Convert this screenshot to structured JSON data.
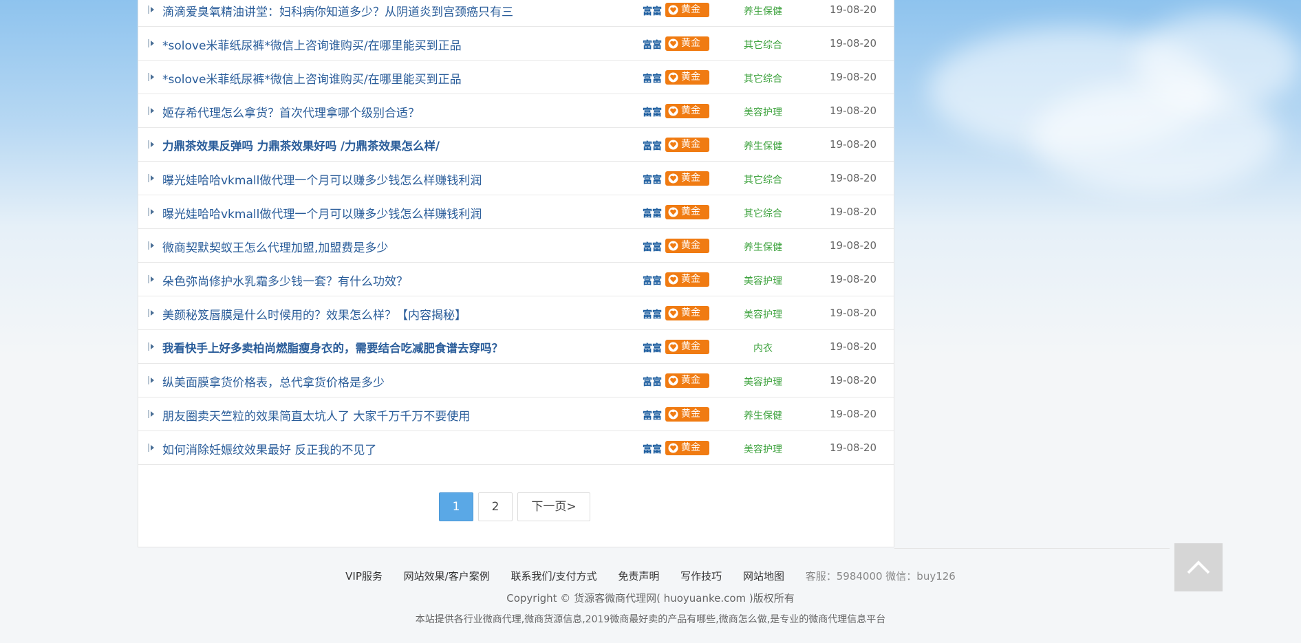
{
  "posts": [
    {
      "title": "滴滴爱臭氧精油讲堂：妇科病你知道多少？从阴道炎到宫颈癌只有三",
      "bold": false,
      "user": "富富",
      "badge": "黄金",
      "category": "养生保健",
      "date": "19-08-20"
    },
    {
      "title": "*solove米菲纸尿裤*微信上咨询谁购买/在哪里能买到正品",
      "bold": false,
      "user": "富富",
      "badge": "黄金",
      "category": "其它综合",
      "date": "19-08-20"
    },
    {
      "title": "*solove米菲纸尿裤*微信上咨询谁购买/在哪里能买到正品",
      "bold": false,
      "user": "富富",
      "badge": "黄金",
      "category": "其它综合",
      "date": "19-08-20"
    },
    {
      "title": "姬存希代理怎么拿货？首次代理拿哪个级别合适？",
      "bold": false,
      "user": "富富",
      "badge": "黄金",
      "category": "美容护理",
      "date": "19-08-20"
    },
    {
      "title": "力鼎茶效果反弹吗 力鼎茶效果好吗 /力鼎茶效果怎么样/",
      "bold": true,
      "user": "富富",
      "badge": "黄金",
      "category": "养生保健",
      "date": "19-08-20"
    },
    {
      "title": "曝光娃哈哈vkmall做代理一个月可以赚多少钱怎么样赚钱利润",
      "bold": false,
      "user": "富富",
      "badge": "黄金",
      "category": "其它综合",
      "date": "19-08-20"
    },
    {
      "title": "曝光娃哈哈vkmall做代理一个月可以赚多少钱怎么样赚钱利润",
      "bold": false,
      "user": "富富",
      "badge": "黄金",
      "category": "其它综合",
      "date": "19-08-20"
    },
    {
      "title": "微商契默契蚁王怎么代理加盟,加盟费是多少",
      "bold": false,
      "user": "富富",
      "badge": "黄金",
      "category": "养生保健",
      "date": "19-08-20"
    },
    {
      "title": "朵色弥尚修护水乳霜多少钱一套？有什么功效？",
      "bold": false,
      "user": "富富",
      "badge": "黄金",
      "category": "美容护理",
      "date": "19-08-20"
    },
    {
      "title": "美颜秘笈唇膜是什么时候用的？效果怎么样？【内容揭秘】",
      "bold": false,
      "user": "富富",
      "badge": "黄金",
      "category": "美容护理",
      "date": "19-08-20"
    },
    {
      "title": "我看快手上好多卖柏尚燃脂瘦身衣的，需要结合吃减肥食谱去穿吗？",
      "bold": true,
      "user": "富富",
      "badge": "黄金",
      "category": "内衣",
      "date": "19-08-20"
    },
    {
      "title": "纵美面膜拿货价格表，总代拿货价格是多少",
      "bold": false,
      "user": "富富",
      "badge": "黄金",
      "category": "美容护理",
      "date": "19-08-20"
    },
    {
      "title": "朋友圈卖天竺粒的效果简直太坑人了 大家千万千万不要使用",
      "bold": false,
      "user": "富富",
      "badge": "黄金",
      "category": "养生保健",
      "date": "19-08-20"
    },
    {
      "title": "如何消除妊娠纹效果最好 反正我的不见了",
      "bold": false,
      "user": "富富",
      "badge": "黄金",
      "category": "美容护理",
      "date": "19-08-20"
    }
  ],
  "pagination": {
    "page1": "1",
    "page2": "2",
    "next": "下一页>"
  },
  "footer": {
    "links": [
      "VIP服务",
      "网站效果/客户案例",
      "联系我们/支付方式",
      "免责声明",
      "写作技巧",
      "网站地图"
    ],
    "service": "客服：5984000 微信：buy126",
    "copyright": "Copyright © 货源客微商代理网( huoyuanke.com )版权所有",
    "description": "本站提供各行业微商代理,微商货源信息,2019微商最好卖的产品有哪些,微商怎么做,是专业的微商代理信息平台"
  },
  "colors": {
    "link": "#2a5d9a",
    "badge": "#f07b12",
    "category": "#3fa33f",
    "pager_active": "#5aa8e6"
  },
  "icons": {
    "row_bullet": "arrow-right-icon",
    "badge": "heart-icon",
    "back_to_top": "chevron-up-icon"
  }
}
